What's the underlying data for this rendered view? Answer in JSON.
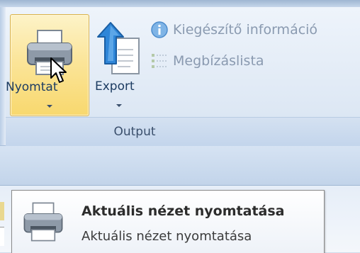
{
  "ribbon": {
    "group_label": "Output",
    "print_button": {
      "label": "Nyomtat",
      "icon": "printer-icon",
      "state": "hover"
    },
    "export_button": {
      "label": "Export",
      "icon": "export-icon"
    },
    "small_items": [
      {
        "label": "Kiegészítő információ",
        "icon": "info-icon",
        "state": "disabled"
      },
      {
        "label": "Megbízáslista",
        "icon": "list-icon",
        "state": "disabled"
      }
    ]
  },
  "popup": {
    "title": "Aktuális nézet nyomtatása",
    "description": "Aktuális nézet nyomtatása",
    "icon": "printer-icon"
  },
  "colors": {
    "hover_fill": "#fbe59a",
    "hover_border": "#d9b24a",
    "label_text": "#1d3c62",
    "disabled_text": "#8a9ab0"
  }
}
